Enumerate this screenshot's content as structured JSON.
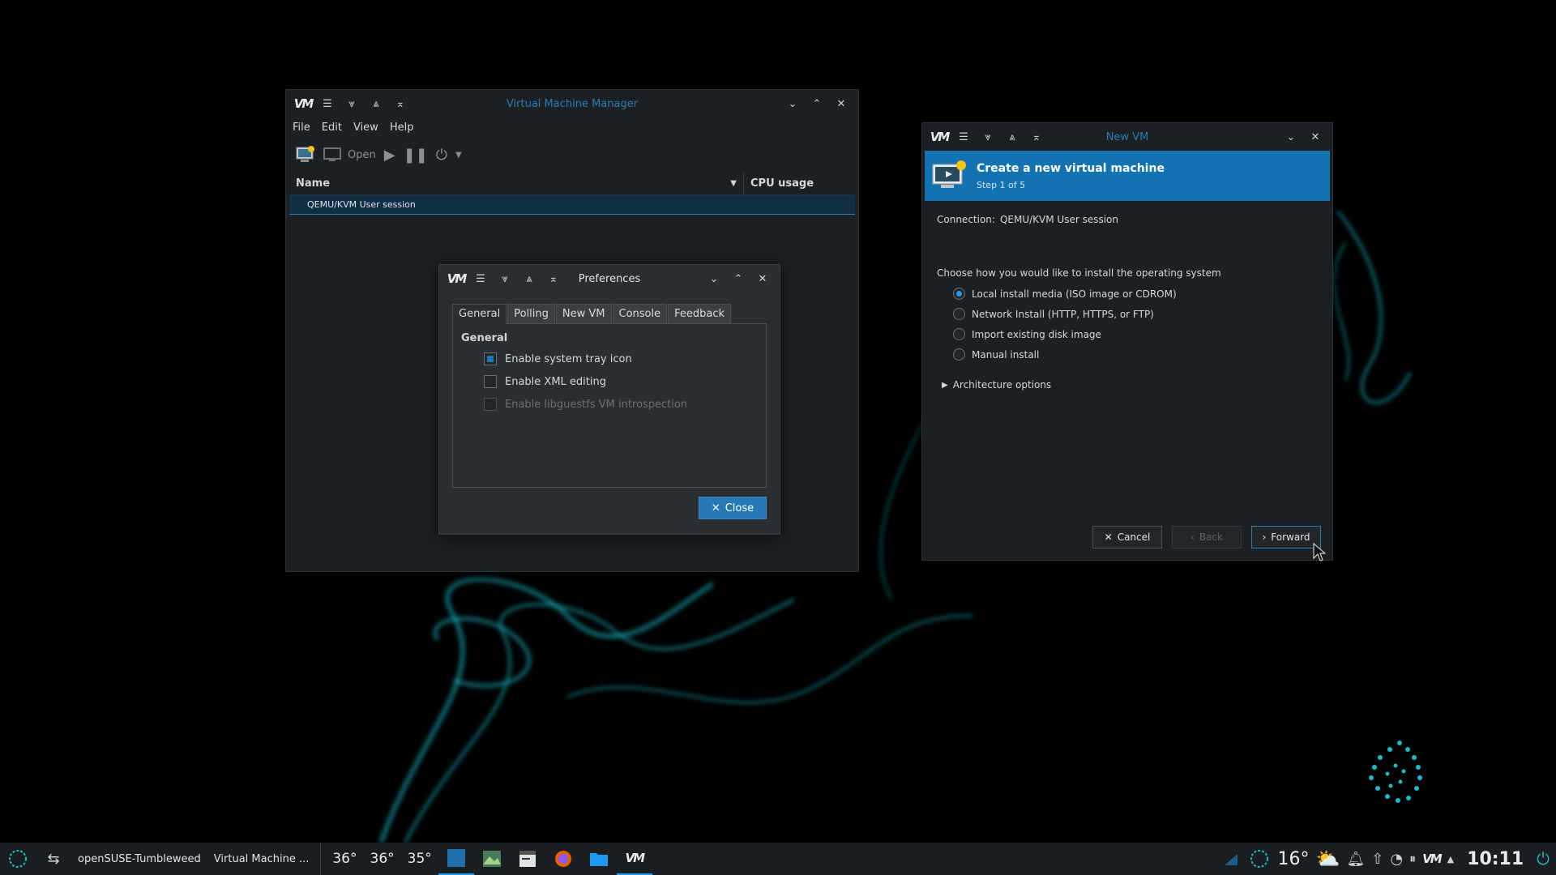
{
  "main_window": {
    "title": "Virtual Machine Manager",
    "menu": [
      "File",
      "Edit",
      "View",
      "Help"
    ],
    "toolbar": {
      "open_label": "Open"
    },
    "columns": {
      "name": "Name",
      "cpu": "CPU usage"
    },
    "rows": [
      "QEMU/KVM User session"
    ]
  },
  "preferences": {
    "title": "Preferences",
    "tabs": [
      "General",
      "Polling",
      "New VM",
      "Console",
      "Feedback"
    ],
    "active_tab": "General",
    "section": "General",
    "options": [
      {
        "label": "Enable system tray icon",
        "checked": true,
        "enabled": true
      },
      {
        "label": "Enable XML editing",
        "checked": false,
        "enabled": true
      },
      {
        "label": "Enable libguestfs VM introspection",
        "checked": false,
        "enabled": false
      }
    ],
    "close_label": "Close"
  },
  "new_vm": {
    "title": "New VM",
    "banner_title": "Create a new virtual machine",
    "banner_step": "Step 1 of 5",
    "connection_label": "Connection:",
    "connection_value": "QEMU/KVM User session",
    "prompt": "Choose how you would like to install the operating system",
    "install_options": [
      {
        "label": "Local install media (ISO image or CDROM)",
        "selected": true
      },
      {
        "label": "Network Install (HTTP, HTTPS, or FTP)",
        "selected": false
      },
      {
        "label": "Import existing disk image",
        "selected": false
      },
      {
        "label": "Manual install",
        "selected": false
      }
    ],
    "architecture_label": "Architecture options",
    "cancel_label": "Cancel",
    "back_label": "Back",
    "forward_label": "Forward"
  },
  "taskbar": {
    "host": "openSUSE-Tumbleweed",
    "active_task": "Virtual Machine ...",
    "temps": [
      "36°",
      "36°",
      "35°"
    ],
    "weather_temp": "16°",
    "clock": "10:11"
  },
  "colors": {
    "accent": "#1d99f3",
    "banner": "#1273b0",
    "window_bg": "#232629",
    "taskbar_bg": "#1b1e20"
  }
}
